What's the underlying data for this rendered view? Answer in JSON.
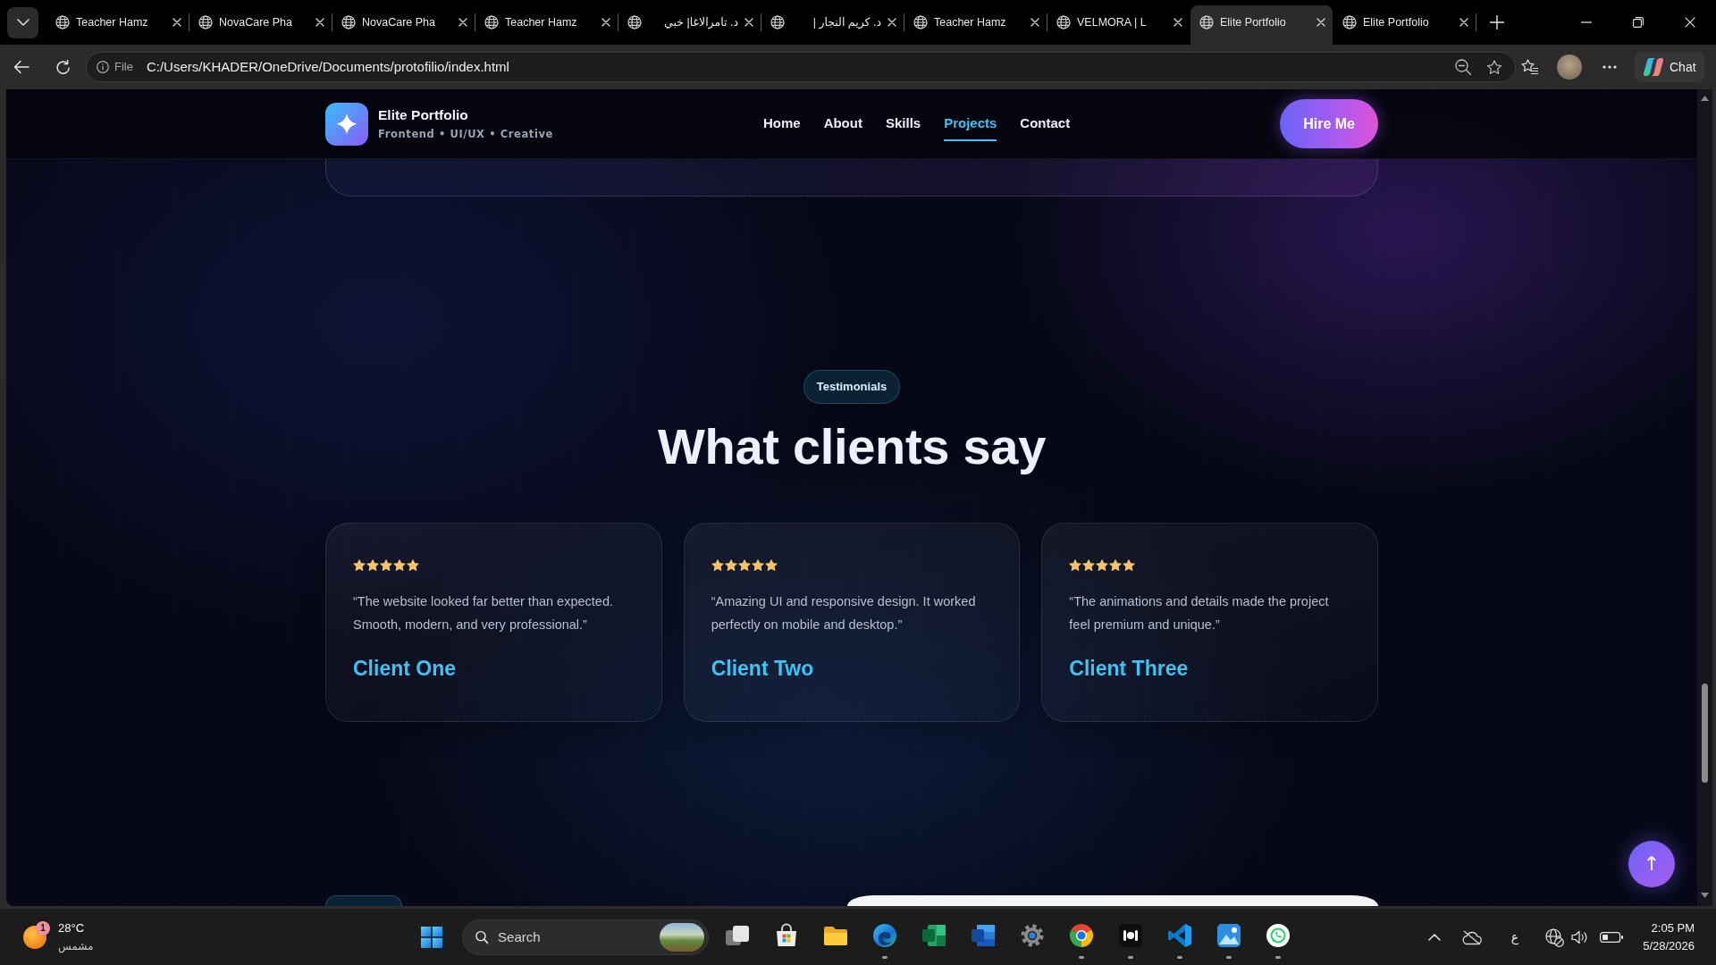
{
  "browser": {
    "tabs": [
      {
        "title": "Teacher Hamz",
        "selected": false
      },
      {
        "title": "NovaCare Pha",
        "selected": false
      },
      {
        "title": "NovaCare Pha",
        "selected": false
      },
      {
        "title": "Teacher Hamz",
        "selected": false
      },
      {
        "title": "د. تامرالاغا| خبي",
        "selected": false
      },
      {
        "title": "د. كريم النجار |",
        "selected": false
      },
      {
        "title": "Teacher Hamz",
        "selected": false
      },
      {
        "title": "VELMORA | L",
        "selected": false
      },
      {
        "title": "Elite Portfolio",
        "selected": true
      },
      {
        "title": "Elite Portfolio",
        "selected": false
      }
    ],
    "address_bar": {
      "scheme": "File",
      "url": "C:/Users/KHADER/OneDrive/Documents/protofilio/index.html"
    },
    "chat_button": "Chat"
  },
  "page": {
    "navbar": {
      "brand": "Elite Portfolio",
      "tagline": "Frontend • UI/UX • Creative",
      "links": [
        {
          "label": "Home",
          "selected": false
        },
        {
          "label": "About",
          "selected": false
        },
        {
          "label": "Skills",
          "selected": false
        },
        {
          "label": "Projects",
          "selected": true
        },
        {
          "label": "Contact",
          "selected": false
        }
      ],
      "cta": "Hire Me"
    },
    "testimonials": {
      "badge": "Testimonials",
      "heading": "What clients say",
      "items": [
        {
          "stars": 5,
          "quote": "“The website looked far better than expected. Smooth, modern, and very professional.”",
          "client": "Client One"
        },
        {
          "stars": 5,
          "quote": "“Amazing UI and responsive design. It worked perfectly on mobile and desktop.”",
          "client": "Client Two"
        },
        {
          "stars": 5,
          "quote": "“The animations and details made the project feel premium and unique.”",
          "client": "Client Three"
        }
      ]
    },
    "back_to_top": {
      "label": "↑"
    }
  },
  "taskbar": {
    "weather": {
      "badge": "1",
      "temperature": "28°C",
      "condition": "مشمس"
    },
    "search": {
      "placeholder": "Search"
    },
    "apps": [
      {
        "kind": "task-view",
        "running": false
      },
      {
        "kind": "store",
        "running": false
      },
      {
        "kind": "file-explorer",
        "running": false
      },
      {
        "kind": "edge",
        "running": true
      },
      {
        "kind": "excel",
        "running": false
      },
      {
        "kind": "word",
        "running": false
      },
      {
        "kind": "settings",
        "running": false
      },
      {
        "kind": "chrome",
        "running": true
      },
      {
        "kind": "media-app",
        "running": true
      },
      {
        "kind": "vscode",
        "running": true
      },
      {
        "kind": "photos",
        "running": true
      },
      {
        "kind": "whatsapp",
        "running": true
      }
    ],
    "tray": {
      "input_language": "ع"
    },
    "clock": {
      "time": "2:05 PM",
      "date": "5/28/2026"
    }
  }
}
